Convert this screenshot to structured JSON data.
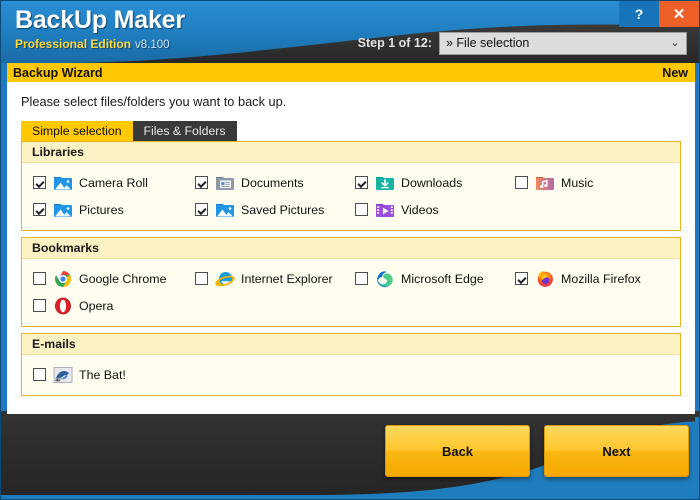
{
  "window": {
    "help_button": "?",
    "close_button": "✕"
  },
  "brand": {
    "title": "BackUp Maker",
    "edition": "Professional Edition",
    "version": "v8.100"
  },
  "header": {
    "step_label": "Step 1 of 12:",
    "step_value": "» File selection",
    "chevron": "⌄"
  },
  "wizard": {
    "title": "Backup Wizard",
    "badge": "New"
  },
  "main": {
    "instruction": "Please select files/folders you want to back up.",
    "tabs": [
      {
        "label": "Simple selection",
        "active": true
      },
      {
        "label": "Files & Folders",
        "active": false
      }
    ],
    "sections": [
      {
        "name": "libraries",
        "title": "Libraries",
        "rows": [
          [
            {
              "label": "Camera Roll",
              "checked": true,
              "icon": "folder-pictures-icon"
            },
            {
              "label": "Documents",
              "checked": true,
              "icon": "folder-documents-icon"
            },
            {
              "label": "Downloads",
              "checked": true,
              "icon": "folder-downloads-icon"
            },
            {
              "label": "Music",
              "checked": false,
              "icon": "folder-music-icon"
            }
          ],
          [
            {
              "label": "Pictures",
              "checked": true,
              "icon": "folder-pictures-icon"
            },
            {
              "label": "Saved Pictures",
              "checked": true,
              "icon": "folder-pictures-icon"
            },
            {
              "label": "Videos",
              "checked": false,
              "icon": "folder-videos-icon"
            }
          ]
        ]
      },
      {
        "name": "bookmarks",
        "title": "Bookmarks",
        "rows": [
          [
            {
              "label": "Google Chrome",
              "checked": false,
              "icon": "chrome-icon"
            },
            {
              "label": "Internet Explorer",
              "checked": false,
              "icon": "internet-explorer-icon"
            },
            {
              "label": "Microsoft Edge",
              "checked": false,
              "icon": "edge-icon"
            },
            {
              "label": "Mozilla Firefox",
              "checked": true,
              "icon": "firefox-icon"
            }
          ],
          [
            {
              "label": "Opera",
              "checked": false,
              "icon": "opera-icon"
            }
          ]
        ]
      },
      {
        "name": "emails",
        "title": "E-mails",
        "rows": [
          [
            {
              "label": "The Bat!",
              "checked": false,
              "icon": "the-bat-icon"
            }
          ]
        ]
      }
    ]
  },
  "footer": {
    "back_label": "Back",
    "next_label": "Next"
  },
  "colors": {
    "brand_blue": "#1f7dbe",
    "accent_yellow": "#ffc800",
    "dark_panel": "#2e2e2e",
    "close_red": "#ef5f28"
  }
}
